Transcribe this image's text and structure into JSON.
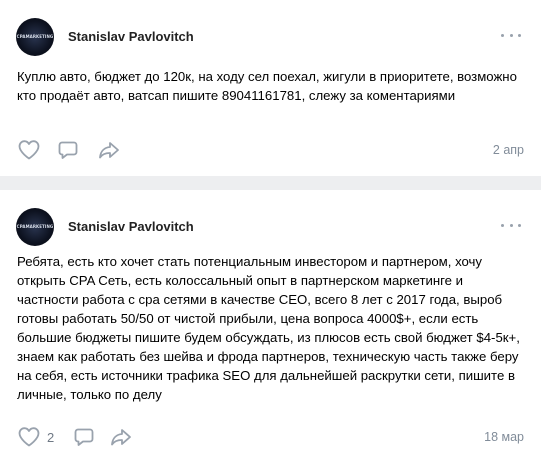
{
  "posts": [
    {
      "author": "Stanislav Pavlovitch",
      "avatar_text": "CPAMARKETING",
      "text": "Куплю авто, бюджет до 120к, на ходу сел поехал, жигули в приоритете, возможно кто продаёт авто, ватсап пишите 89041161781, слежу за коментариями",
      "likes": "",
      "date": "2 апр"
    },
    {
      "author": "Stanislav Pavlovitch",
      "avatar_text": "CPAMARKETING",
      "text": "Ребята, есть кто хочет стать потенциальным инвестором и партнером, хочу открыть CPA Сеть, есть колоссальный опыт в партнерском маркетинге и частности работа с сра сетями в качестве CEO, всего 8 лет с 2017 года, выроб готовы работать 50/50 от чистой прибыли, цена вопроса 4000$+, если есть большие бюджеты пишите будем обсуждать, из плюсов есть свой бюджет $4-5к+, знаем как работать без шейва и фрода партнеров, техническую часть также беру на себя, есть источники трафика SEO для дальнейшей раскрутки сети, пишите в личные, только по делу",
      "likes": "2",
      "date": "18 мар"
    }
  ],
  "icons": {
    "like": "heart-icon",
    "comment": "comment-icon",
    "share": "share-icon",
    "more": "more-dots-icon"
  },
  "colors": {
    "background": "#edeef0",
    "card": "#ffffff",
    "icon": "#99a2ad",
    "secondary_text": "#818c99"
  }
}
